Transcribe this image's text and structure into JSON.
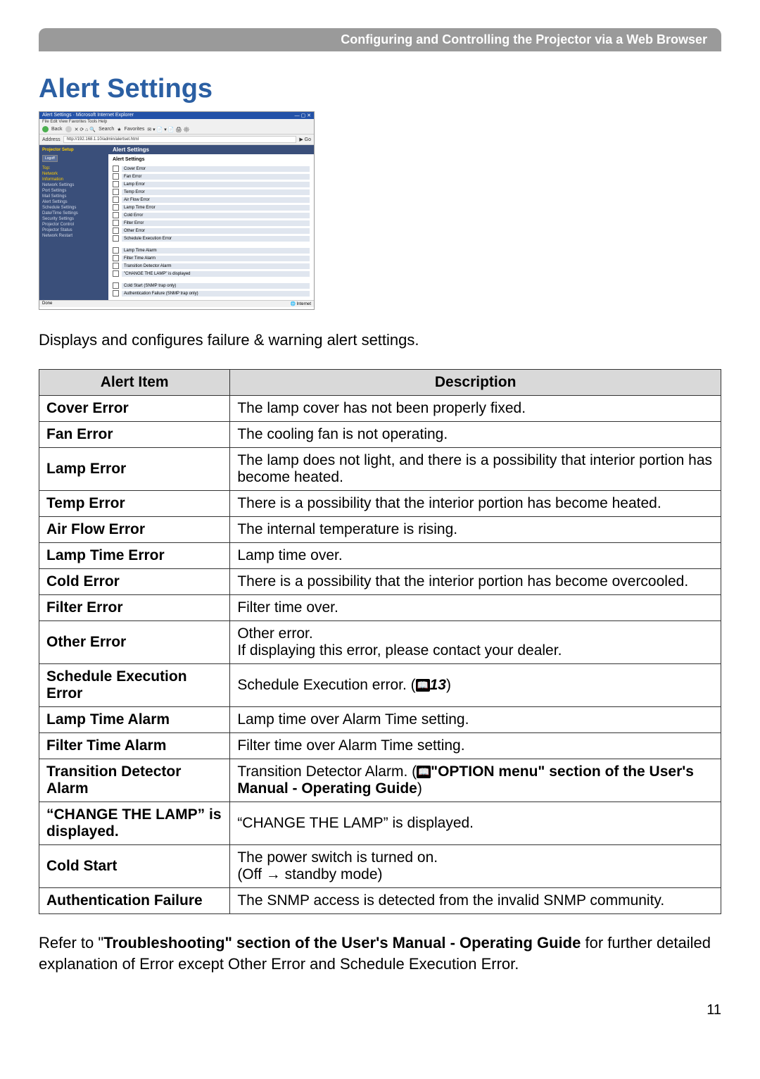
{
  "header_bar": "Configuring and Controlling the Projector via a Web Browser",
  "heading": "Alert Settings",
  "intro": "Displays and configures failure & warning alert settings.",
  "screenshot": {
    "title": "Alert Settings · Microsoft Internet Explorer",
    "menu": "File  Edit  View  Favorites  Tools  Help",
    "back": "Back",
    "search": "Search",
    "fav": "Favorites",
    "addr_label": "Address",
    "addr": "http://192.168.1.10/admin/alertset.html",
    "go": "Go",
    "setup": "Projector Setup",
    "logoff": "Logoff",
    "links": [
      "Top:",
      "Network",
      "Information"
    ],
    "items": [
      "Network Settings",
      "Port Settings",
      "Mail Settings",
      "Alert Settings",
      "Schedule Settings",
      "Date/Time Settings",
      "Security Settings",
      "Projector Control",
      "Projector Status",
      "Network Restart"
    ],
    "main_header": "Alert Settings",
    "sub": "Alert Settings",
    "rows1": [
      "Cover Error",
      "Fan Error",
      "Lamp Error",
      "Temp Error",
      "Air Flow Error",
      "Lamp Time Error",
      "Cold Error",
      "Filter Error",
      "Other Error",
      "Schedule Execution Error"
    ],
    "rows2": [
      "Lamp Time Alarm",
      "Filter Time Alarm",
      "Transition Detector Alarm",
      "\"CHANGE THE LAMP\" is displayed"
    ],
    "rows3": [
      "Cold Start (SNMP trap only)",
      "Authentication Failure (SNMP trap only)"
    ],
    "status_left": "Done",
    "status_right": "Internet"
  },
  "columns": {
    "item": "Alert Item",
    "desc": "Description"
  },
  "rows": [
    {
      "item": "Cover Error",
      "desc": "The lamp cover has not been properly fixed."
    },
    {
      "item": "Fan Error",
      "desc": "The cooling fan is not operating."
    },
    {
      "item": "Lamp Error",
      "desc": "The lamp does not light, and there is a possibility that interior portion has become heated."
    },
    {
      "item": "Temp Error",
      "desc": "There is a possibility that the interior portion has become heated."
    },
    {
      "item": "Air Flow Error",
      "desc": "The internal temperature is rising."
    },
    {
      "item": "Lamp Time Error",
      "desc": "Lamp time over."
    },
    {
      "item": "Cold Error",
      "desc": "There is a possibility that the interior portion has become overcooled."
    },
    {
      "item": "Filter Error",
      "desc": "Filter time over."
    },
    {
      "item": "Other Error",
      "desc_a": "Other error.",
      "desc_b": "If displaying this error, please contact your dealer."
    },
    {
      "item": "Schedule Execution Error",
      "desc_pre": "Schedule Execution error. (",
      "ref": "13",
      "desc_post": ")"
    },
    {
      "item": "Lamp Time Alarm",
      "desc": "Lamp time over Alarm Time setting."
    },
    {
      "item": "Filter Time Alarm",
      "desc": "Filter time over Alarm Time setting."
    },
    {
      "item": "Transition Detector Alarm",
      "desc_pre": "Transition Detector Alarm. (",
      "bold": "\"OPTION menu\" section of the User's Manual - Operating Guide",
      "desc_post": ")"
    },
    {
      "item": "“CHANGE THE LAMP” is displayed.",
      "desc": "“CHANGE THE LAMP” is displayed."
    },
    {
      "item": "Cold Start",
      "desc_a": "The power switch is turned on.",
      "desc_b": "(Off → standby mode)"
    },
    {
      "item": "Authentication Failure",
      "desc": "The SNMP access is detected from the invalid SNMP community."
    }
  ],
  "footnote": {
    "pre": "Refer to \"",
    "bold": "Troubleshooting\" section of the User's Manual - Operating Guide",
    "post": " for further detailed explanation of Error except Other Error and Schedule Execution Error."
  },
  "page_number": "11"
}
